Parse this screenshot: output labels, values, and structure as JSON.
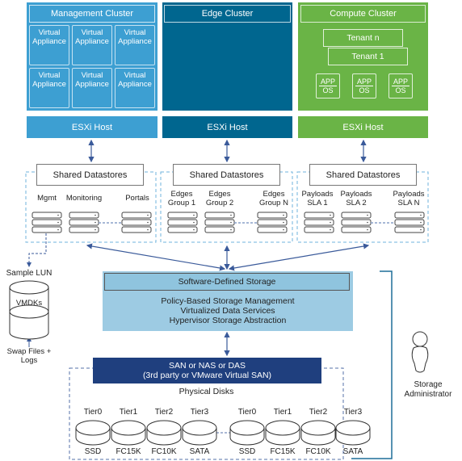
{
  "colors": {
    "management": "#3d9fd2",
    "edge": "#00668f",
    "compute": "#6ab446",
    "sds": "#9dcbe3",
    "san": "#1f3f7e",
    "line": "#3a5a9a"
  },
  "management": {
    "title": "Management Cluster",
    "appliance_label": "Virtual Appliance",
    "appliances": [
      "Virtual Appliance",
      "Virtual Appliance",
      "Virtual Appliance",
      "Virtual Appliance",
      "Virtual Appliance",
      "Virtual Appliance"
    ],
    "host": "ESXi Host"
  },
  "edge": {
    "title": "Edge Cluster",
    "host": "ESXi Host"
  },
  "compute": {
    "title": "Compute Cluster",
    "tenants": [
      "Tenant n",
      "Tenant 1"
    ],
    "vms": [
      {
        "app": "APP",
        "os": "OS"
      },
      {
        "app": "APP",
        "os": "OS"
      },
      {
        "app": "APP",
        "os": "OS"
      }
    ],
    "host": "ESXi Host"
  },
  "datastores": [
    {
      "title": "Shared Datastores",
      "labels": [
        "Mgmt",
        "Monitoring",
        "Portals"
      ]
    },
    {
      "title": "Shared Datastores",
      "labels": [
        "Edges Group 1",
        "Edges Group 2",
        "Edges Group N"
      ]
    },
    {
      "title": "Shared Datastores",
      "labels": [
        "Payloads SLA 1",
        "Payloads SLA 2",
        "Payloads SLA N"
      ]
    }
  ],
  "lun": {
    "title": "Sample LUN",
    "top": "VMDKs",
    "bottom": "Swap Files + Logs"
  },
  "sds": {
    "title": "Software-Defined Storage",
    "lines": [
      "Policy-Based Storage Management",
      "Virtualized Data Services",
      "Hypervisor Storage Abstraction"
    ]
  },
  "san": {
    "line1": "SAN or NAS or DAS",
    "line2": "(3rd party or VMware Virtual SAN)"
  },
  "physical": {
    "title": "Physical Disks",
    "disks": [
      {
        "tier": "Tier0",
        "type": "SSD"
      },
      {
        "tier": "Tier1",
        "type": "FC15K"
      },
      {
        "tier": "Tier2",
        "type": "FC10K"
      },
      {
        "tier": "Tier3",
        "type": "SATA"
      },
      {
        "tier": "Tier0",
        "type": "SSD"
      },
      {
        "tier": "Tier1",
        "type": "FC15K"
      },
      {
        "tier": "Tier2",
        "type": "FC10K"
      },
      {
        "tier": "Tier3",
        "type": "SATA"
      }
    ]
  },
  "admin": {
    "label": "Storage Administrator"
  }
}
